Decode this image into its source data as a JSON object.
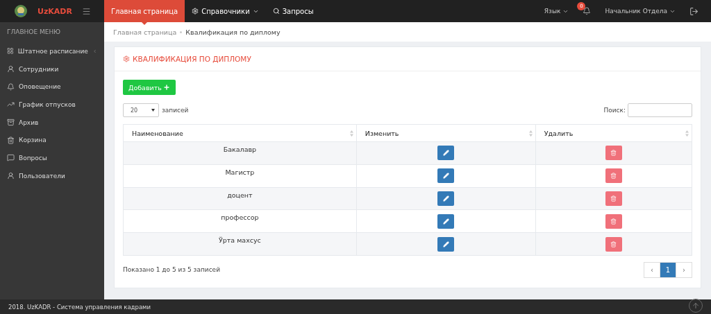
{
  "topbar": {
    "brand": "UzKADR",
    "nav": [
      {
        "label": "Главная страница",
        "selected": true,
        "kind": "link"
      },
      {
        "label": "Справочники",
        "selected": false,
        "kind": "dropdown"
      },
      {
        "label": "Запросы",
        "selected": false,
        "kind": "search"
      }
    ],
    "language": "Язык",
    "notifications": "0",
    "user": "Начальник Отдела"
  },
  "sidebar": {
    "heading": "ГЛАВНОЕ МЕНЮ",
    "items": [
      {
        "label": "Штатное расписание",
        "kind": "grid",
        "expandable": true
      },
      {
        "label": "Сотрудники",
        "kind": "user",
        "expandable": false
      },
      {
        "label": "Оповещение",
        "kind": "bell",
        "expandable": false
      },
      {
        "label": "График отпусков",
        "kind": "chart",
        "expandable": false
      },
      {
        "label": "Архив",
        "kind": "archive",
        "expandable": false
      },
      {
        "label": "Корзина",
        "kind": "trash",
        "expandable": false
      },
      {
        "label": "Вопросы",
        "kind": "message",
        "expandable": false
      },
      {
        "label": "Пользователи",
        "kind": "user",
        "expandable": false
      }
    ]
  },
  "breadcrumb": [
    "Главная страница",
    "Квалификация по диплому"
  ],
  "card": {
    "title": "КВАЛИФИКАЦИЯ ПО ДИПЛОМУ",
    "add_button": "Добавить",
    "page_length": "20",
    "page_length_label": "записей",
    "search_label": "Поиск:",
    "table": {
      "columns": [
        "Наименование",
        "Изменить",
        "Удалить"
      ],
      "rows": [
        {
          "name": "Бакалавр"
        },
        {
          "name": "Магистр"
        },
        {
          "name": "доцент"
        },
        {
          "name": "профессор"
        },
        {
          "name": "Ўрта махсус"
        }
      ]
    },
    "info": "Показано 1 до 5 из 5 записей",
    "pagination": [
      {
        "label": "‹",
        "selected": false
      },
      {
        "label": "1",
        "selected": true
      },
      {
        "label": "›",
        "selected": false
      }
    ]
  },
  "footer": "2018. UzKADR - Система управления кадрами"
}
